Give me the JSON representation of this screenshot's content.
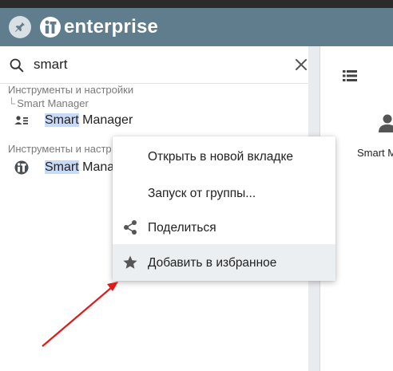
{
  "app": {
    "brand": "enterprise"
  },
  "search": {
    "value": "smart",
    "placeholder": ""
  },
  "results": {
    "group1": {
      "category": "Инструменты и настройки",
      "path": "Smart Manager",
      "item_highlight": "Smart",
      "item_rest": " Manager"
    },
    "group2": {
      "category": "Инструменты и настр",
      "item_highlight": "Smart",
      "item_rest": " Mana"
    }
  },
  "context_menu": {
    "items": [
      {
        "label": "Открыть в новой вкладке",
        "icon": ""
      },
      {
        "label": "Запуск от группы...",
        "icon": ""
      },
      {
        "label": "Поделиться",
        "icon": "share-icon"
      },
      {
        "label": "Добавить в избранное",
        "icon": "star-icon"
      }
    ]
  },
  "right_panel": {
    "label": "Smart M"
  },
  "colors": {
    "appbar": "#5f7d8d",
    "highlight": "#c8daf7",
    "arrow": "#e0191b"
  }
}
